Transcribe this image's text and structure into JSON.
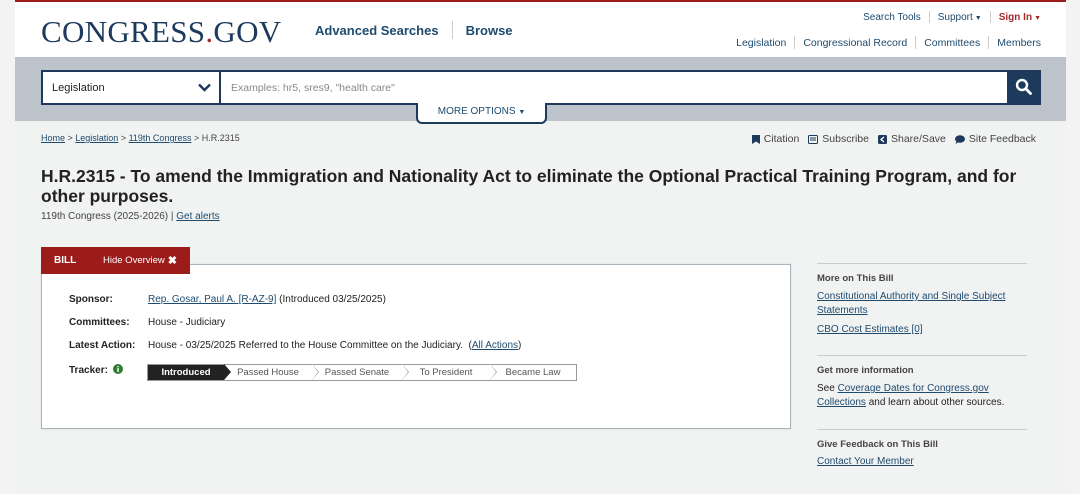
{
  "header": {
    "logo_main": "CONGRESS",
    "logo_dot": ".",
    "logo_tld": "GOV",
    "main_nav": [
      "Advanced Searches",
      "Browse"
    ],
    "util_nav": {
      "search_tools": "Search Tools",
      "support": "Support",
      "sign_in": "Sign In"
    },
    "sub_nav": [
      "Legislation",
      "Congressional Record",
      "Committees",
      "Members"
    ]
  },
  "search": {
    "collection": "Legislation",
    "placeholder": "Examples: hr5, sres9, \"health care\"",
    "more_options": "MORE OPTIONS"
  },
  "breadcrumb": {
    "items": [
      "Home",
      "Legislation",
      "119th Congress"
    ],
    "current": "H.R.2315"
  },
  "tools": [
    "Citation",
    "Subscribe",
    "Share/Save",
    "Site Feedback"
  ],
  "bill": {
    "title": "H.R.2315 - To amend the Immigration and Nationality Act to eliminate the Optional Practical Training Program, and for other purposes.",
    "congress": "119th Congress (2025-2026)",
    "get_alerts": "Get alerts",
    "tab_label": "BILL",
    "hide_overview": "Hide Overview",
    "sponsor_label": "Sponsor:",
    "sponsor_name": "Rep. Gosar, Paul A. [R-AZ-9]",
    "sponsor_intro": "(Introduced 03/25/2025)",
    "committees_label": "Committees:",
    "committees_value": "House - Judiciary",
    "latest_action_label": "Latest Action:",
    "latest_action_value": "House - 03/25/2025 Referred to the House Committee on the Judiciary.",
    "all_actions": "All Actions",
    "tracker_label": "Tracker:",
    "tracker_stages": [
      "Introduced",
      "Passed House",
      "Passed Senate",
      "To President",
      "Became Law"
    ],
    "tracker_current": "Introduced"
  },
  "sidebar": {
    "more_title": "More on This Bill",
    "more_links": [
      "Constitutional Authority and Single Subject Statements",
      "CBO Cost Estimates [0]"
    ],
    "info_title": "Get more information",
    "info_prefix": "See",
    "info_link": "Coverage Dates for Congress.gov Collections",
    "info_suffix": "and learn about other sources.",
    "feedback_title": "Give Feedback on This Bill",
    "feedback_link": "Contact Your Member"
  },
  "colors": {
    "brand_navy": "#1d3a5c",
    "brand_red": "#9c1b1b",
    "link": "#1e4b6e"
  }
}
